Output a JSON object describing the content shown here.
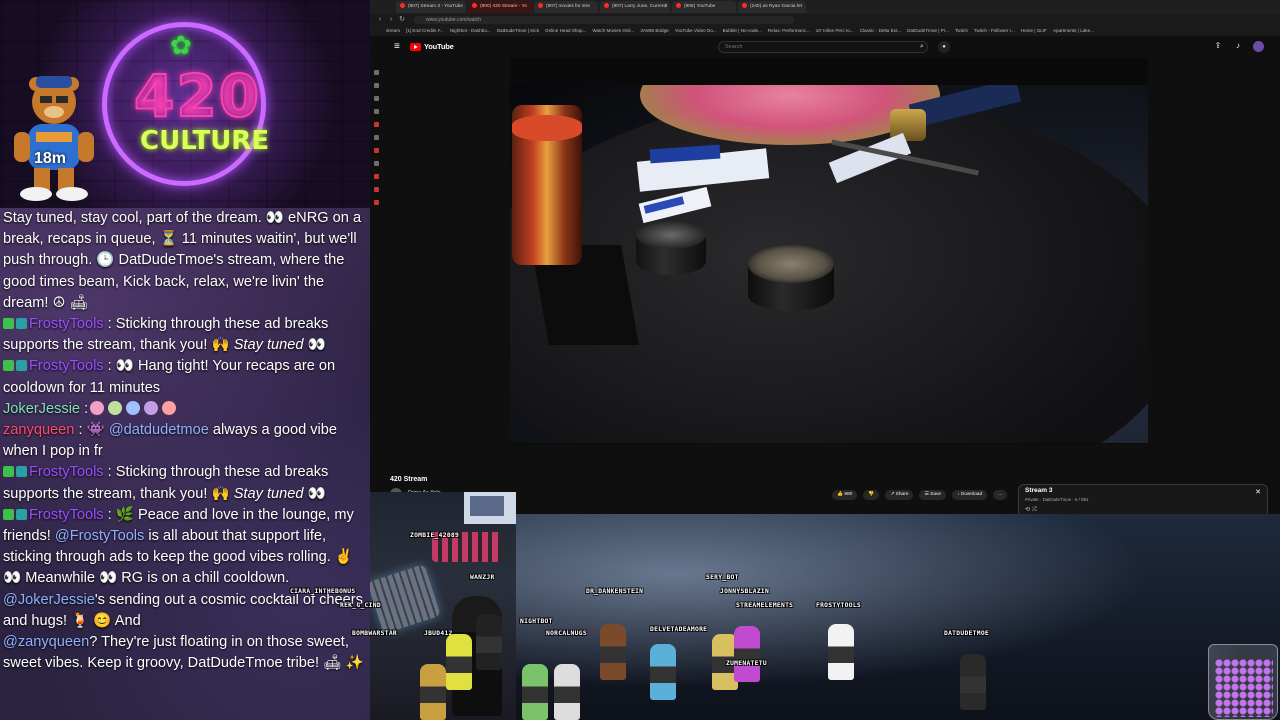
{
  "overlay": {
    "logo_number": "420",
    "logo_word": "CULTURE",
    "mascot_timer": "18m"
  },
  "chat": {
    "messages": [
      {
        "user": "",
        "text": "Stay tuned, stay cool, part of the dream. 👀 eNRG on a break, recaps in queue, ⏳ 11 minutes waitin', but we'll push through. 🕒 DatDudeTmoe's stream, where the good times beam, Kick back, relax, we're livin' the dream! ☮ 🛋"
      },
      {
        "user": "FrostyTools",
        "text": ": Sticking through these ad breaks supports the stream, thank you! 🙌 ",
        "italic": "Stay tuned",
        "tail": " 👀"
      },
      {
        "user": "FrostyTools",
        "text": ": 👀 Hang tight! Your recaps are on cooldown for 11 minutes"
      },
      {
        "user": "JokerJessie",
        "text": ":"
      },
      {
        "user": "zanyqueen",
        "text": ": 👾 ",
        "mention": "@datdudetmoe",
        "tail": " always a good vibe when I pop in fr"
      },
      {
        "user": "FrostyTools",
        "text": ": Sticking through these ad breaks supports the stream, thank you! 🙌 ",
        "italic": "Stay tuned",
        "tail": " 👀"
      },
      {
        "user": "FrostyTools",
        "text": ": 🌿 Peace and love in the lounge, my friends! ",
        "mention": "@FrostyTools",
        "tail": " is all about that support life, sticking through ads to keep the good vibes rolling. ✌ 👀 Meanwhile 👀 RG is on a chill cooldown. "
      },
      {
        "user": "",
        "text": "",
        "mention": "@JokerJessie",
        "tail": "'s sending out a cosmic cocktail of cheers and hugs! 🍹 😊 And "
      },
      {
        "user": "",
        "text": "",
        "mention": "@zanyqueen",
        "tail": "? They're just floating in on those sweet, sweet vibes. Keep it groovy, DatDudeTmoe tribe! 🛋 ✨"
      }
    ]
  },
  "browser": {
    "tabs": [
      "(907) Stream 3 - YouTube",
      "(900) 420 Stream - Yo",
      "(907) movies for stre",
      "(907) Larry June, Curren$",
      "(905) YouTube",
      "(240) as Ryan Garcia let"
    ],
    "active_tab": 1,
    "url": "www.youtube.com/watch",
    "bookmarks": [
      "stream",
      "[1] End Credits F...",
      "Nightbot - Dashbo...",
      "DatDudeTmoe | Kick",
      "Online Head Shop...",
      "Watch Movies Onli...",
      "3AMW Bridge",
      "YouTube Video Do...",
      "Bubble | No-code...",
      "Relax: Performanc...",
      "10' Inline Perc to...",
      "Classic - Delta Ext...",
      "DatDudeTmoe | Pr...",
      "Twitch",
      "Twitch - Follower r...",
      "Home | GLIF",
      "Apartments | Lake..."
    ]
  },
  "youtube": {
    "logo_text": "YouTube",
    "search_placeholder": "Search",
    "video_title": "420 Stream",
    "channel": "Dope As Yola",
    "likes": "960",
    "share": "Share",
    "save": "Save",
    "download": "Download",
    "more": "...",
    "playlist_title": "Stream 3",
    "playlist_sub": "Private · DatDudeTmoe - 6 / 891"
  },
  "game": {
    "names": [
      {
        "n": "ZOMBIE_42089"
      },
      {
        "n": "WANZJR"
      },
      {
        "n": "CIARA_INTHEBONUS"
      },
      {
        "n": "REK_G_CIND"
      },
      {
        "n": "BOMBWARSTAR"
      },
      {
        "n": "JBUD412"
      },
      {
        "n": "NIGHTBOT"
      },
      {
        "n": "NORCALNUGS"
      },
      {
        "n": "DR_DANKENSTEIN"
      },
      {
        "n": "DELVETADEAMORE"
      },
      {
        "n": "SERY_BOT"
      },
      {
        "n": "JONNYSBLAZIN"
      },
      {
        "n": "STREAMELEMENTS"
      },
      {
        "n": "ZUMENATETU"
      },
      {
        "n": "FROSTYTOOLS"
      },
      {
        "n": "DATDUDETMOE"
      }
    ]
  }
}
